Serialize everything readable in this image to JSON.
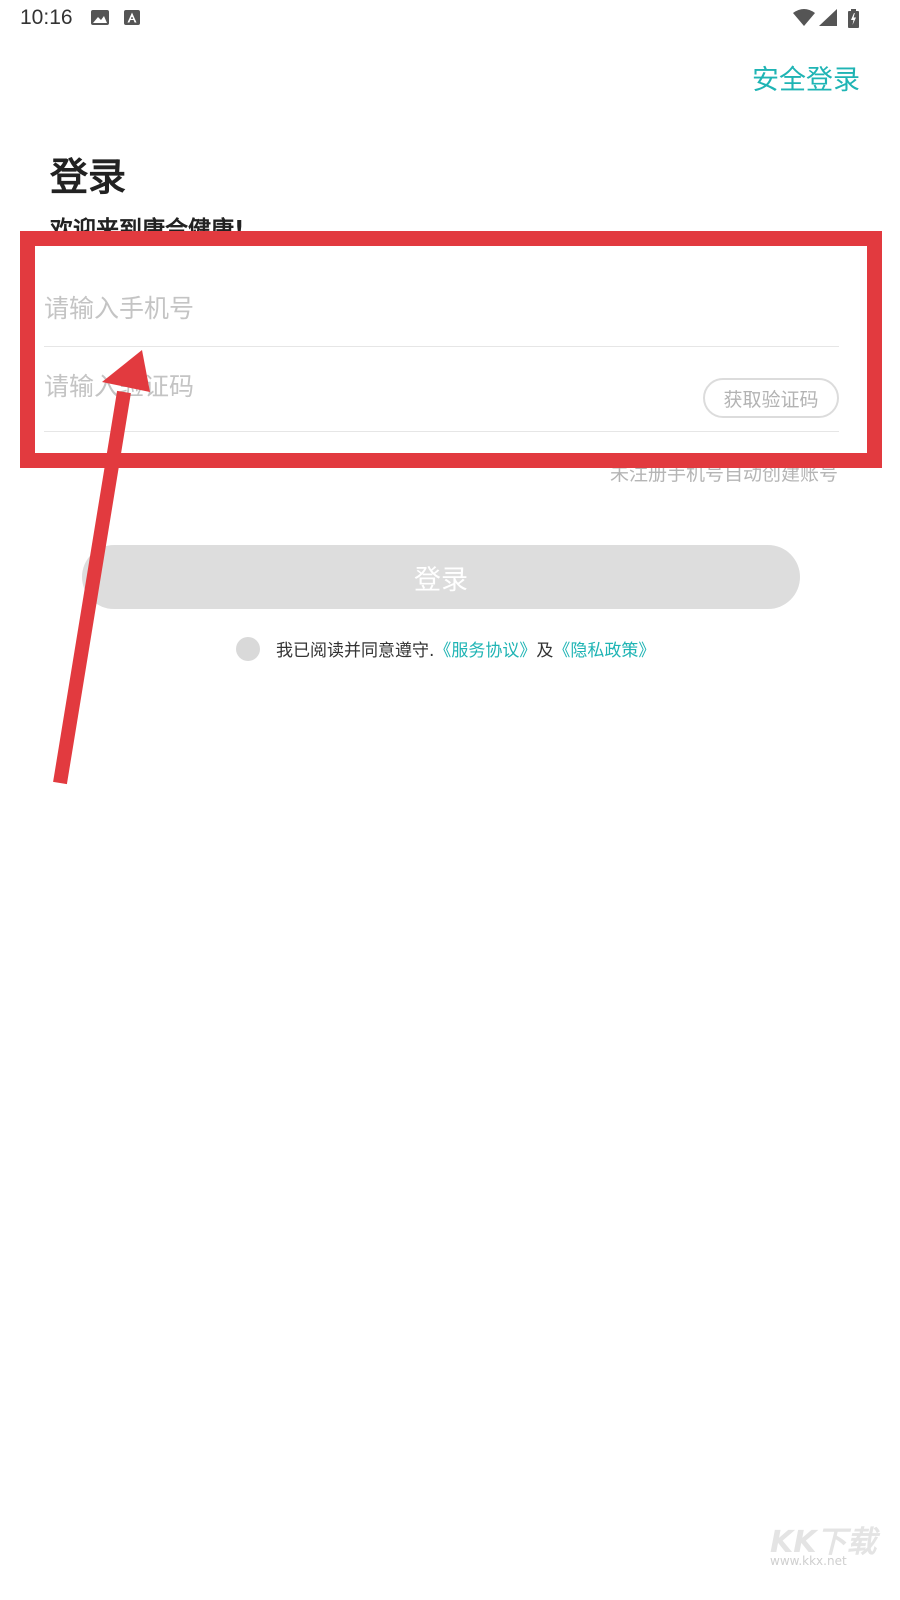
{
  "status_bar": {
    "time": "10:16",
    "icons_left": [
      "image-icon",
      "a-notification-icon"
    ],
    "icons_right": [
      "wifi-icon",
      "signal-icon",
      "battery-icon"
    ]
  },
  "header": {
    "secure_login": "安全登录"
  },
  "title": "登录",
  "welcome": "欢迎来到康合健康!",
  "phone_input": {
    "placeholder": "请输入手机号",
    "value": ""
  },
  "code_input": {
    "placeholder": "请输入验证码",
    "value": ""
  },
  "get_code_button": "获取验证码",
  "hint": "未注册手机号自动创建账号",
  "login_button": "登录",
  "agreement": {
    "prefix": "我已阅读并同意遵守.",
    "service_link": "《服务协议》",
    "and": "及",
    "privacy_link": "《隐私政策》",
    "checked": false
  },
  "watermark": {
    "logo": "KK下载",
    "url": "www.kkx.net"
  },
  "colors": {
    "accent": "#1fb4b4",
    "annotation": "#e23a3f",
    "button_disabled": "#dddddd",
    "placeholder": "#c4c4c4"
  }
}
